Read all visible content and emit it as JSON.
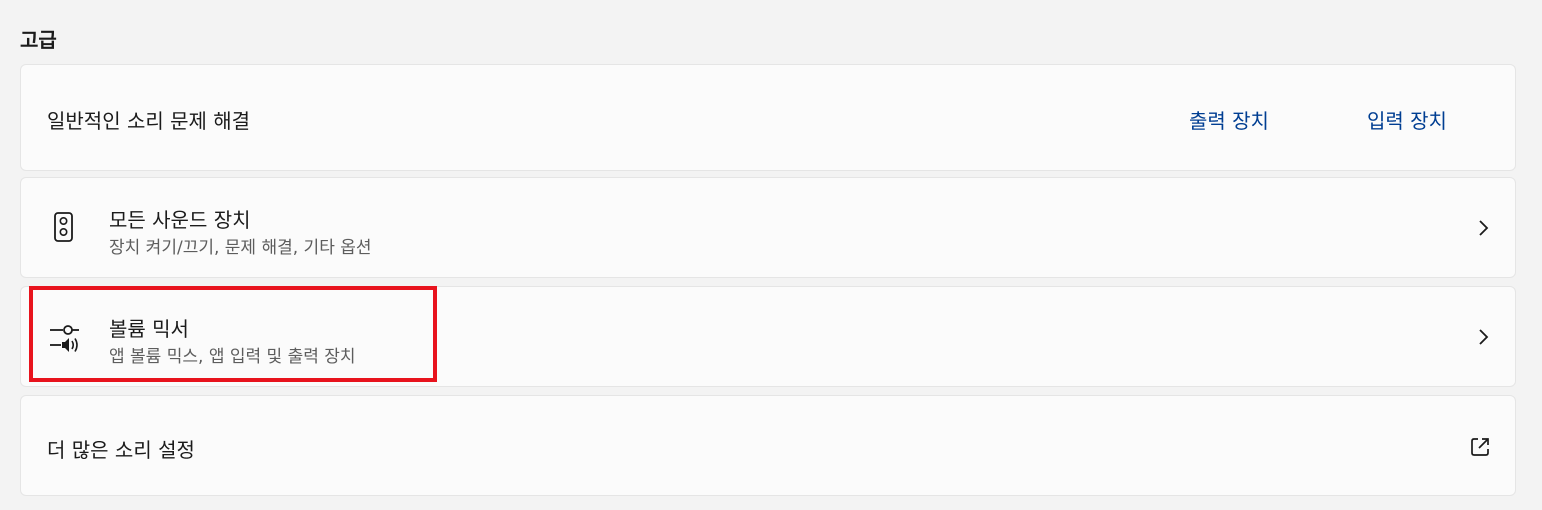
{
  "section": {
    "title": "고급"
  },
  "troubleshoot": {
    "label": "일반적인 소리 문제 해결",
    "output_link": "출력 장치",
    "input_link": "입력 장치"
  },
  "all_devices": {
    "title": "모든 사운드 장치",
    "subtitle": "장치 켜기/끄기, 문제 해결, 기타 옵션",
    "icon": "speaker-icon"
  },
  "volume_mixer": {
    "title": "볼륨 믹서",
    "subtitle": "앱 볼륨 믹스, 앱 입력 및 출력 장치",
    "icon": "volume-mixer-icon",
    "highlighted": true
  },
  "more_settings": {
    "title": "더 많은 소리 설정",
    "icon": "open-external-icon"
  },
  "colors": {
    "link": "#003e92",
    "highlight": "#e8131d",
    "background": "#f3f3f3",
    "card": "#fbfbfb"
  }
}
